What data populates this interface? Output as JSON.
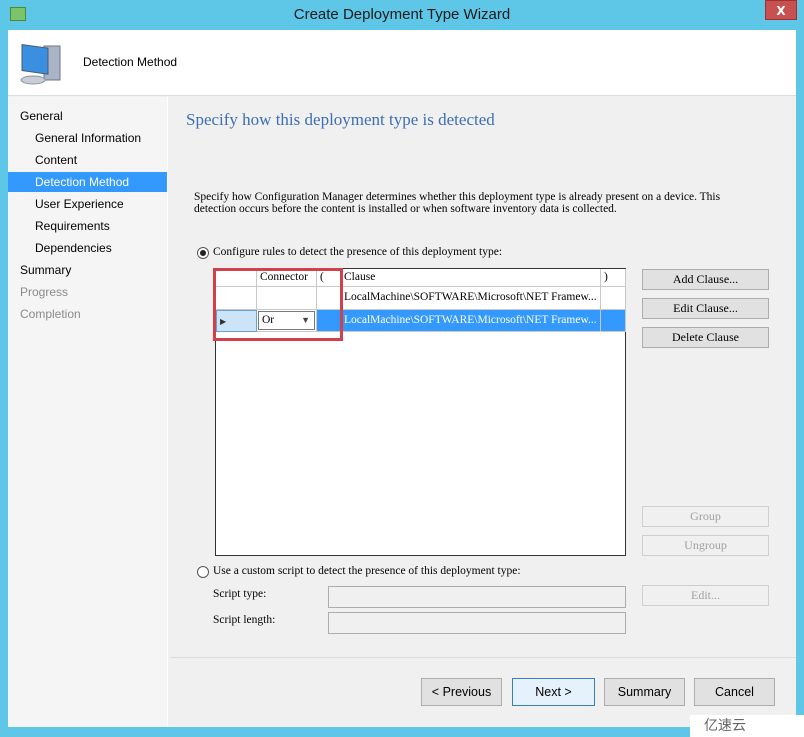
{
  "window": {
    "title": "Create Deployment Type Wizard",
    "close_label": "X"
  },
  "header": {
    "title": "Detection Method"
  },
  "sidebar": {
    "items": [
      {
        "label": "General",
        "state": "normal"
      },
      {
        "label": "General Information",
        "state": "normal"
      },
      {
        "label": "Content",
        "state": "normal"
      },
      {
        "label": "Detection Method",
        "state": "selected"
      },
      {
        "label": "User Experience",
        "state": "normal"
      },
      {
        "label": "Requirements",
        "state": "normal"
      },
      {
        "label": "Dependencies",
        "state": "normal"
      },
      {
        "label": "Summary",
        "state": "normal"
      },
      {
        "label": "Progress",
        "state": "disabled"
      },
      {
        "label": "Completion",
        "state": "disabled"
      }
    ]
  },
  "main": {
    "title": "Specify how this deployment type is detected",
    "description": "Specify how Configuration Manager determines whether this deployment type is already present on a device. This detection occurs before the content is installed or when software inventory data is collected.",
    "rules_option": {
      "label": "Configure rules to detect the presence of this deployment type:",
      "selected": true
    },
    "grid": {
      "columns": [
        "",
        "Connector",
        "(",
        "Clause",
        ")"
      ],
      "rows": [
        {
          "connector": "",
          "open": "",
          "clause": "LocalMachine\\SOFTWARE\\Microsoft\\NET Framew...",
          "close": "",
          "selected": false
        },
        {
          "connector": "Or",
          "open": "",
          "clause": "LocalMachine\\SOFTWARE\\Microsoft\\NET Framew...",
          "close": "",
          "selected": true
        }
      ]
    },
    "buttons": {
      "add_clause": "Add Clause...",
      "edit_clause": "Edit Clause...",
      "delete_clause": "Delete Clause",
      "group": "Group",
      "ungroup": "Ungroup"
    },
    "script_option": {
      "label": "Use a custom script to detect the presence of this deployment type:",
      "selected": false
    },
    "script_type_label": "Script type:",
    "script_type_value": "",
    "script_length_label": "Script length:",
    "script_length_value": "",
    "edit_button": "Edit..."
  },
  "footer": {
    "previous": "< Previous",
    "next": "Next >",
    "summary": "Summary",
    "cancel": "Cancel"
  },
  "watermark": "亿速云",
  "colors": {
    "titlebar": "#5ec6e6",
    "selection": "#3399ff",
    "highlight_box": "#d0414b",
    "title_text": "#3c6eb4"
  }
}
